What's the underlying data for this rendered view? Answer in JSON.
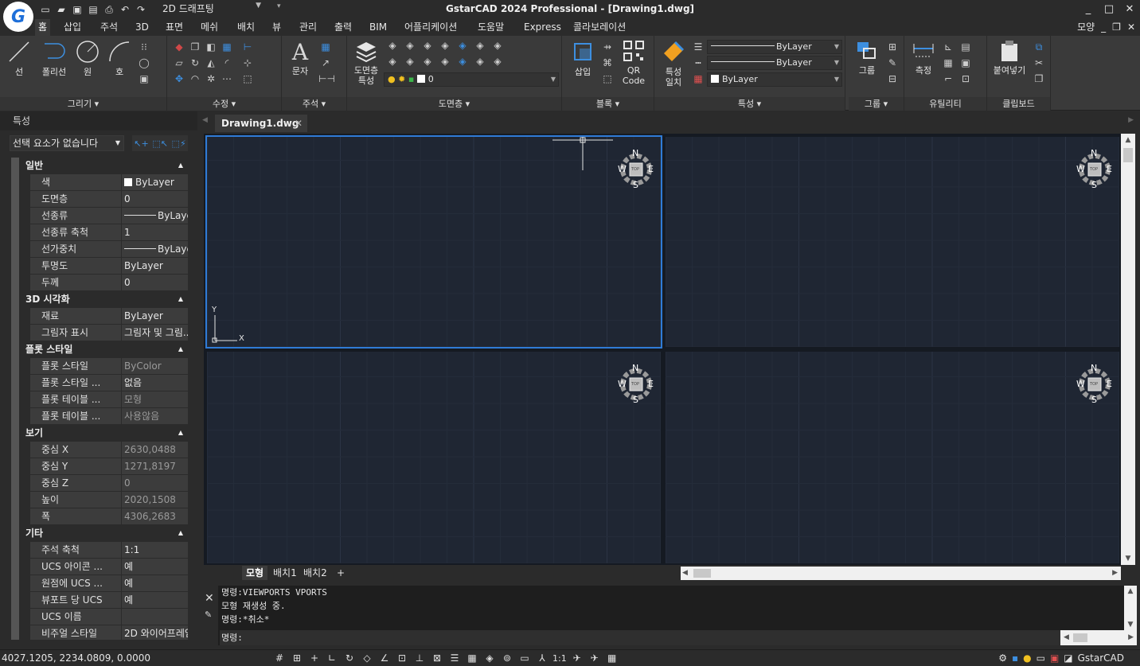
{
  "window": {
    "title": "GstarCAD 2024 Professional - [Drawing1.dwg]",
    "logo_letter": "G",
    "workspace": "2D 드래프팅",
    "controls": [
      "_",
      "□",
      "✕"
    ]
  },
  "ribbon_tabs": [
    "홈",
    "삽입",
    "주석",
    "3D",
    "표면",
    "메쉬",
    "배치",
    "뷰",
    "관리",
    "출력",
    "BIM",
    "어플리케이션",
    "도움말",
    "Express",
    "콜라보레이션"
  ],
  "active_tab": "홈",
  "tabs_right": {
    "label": "모양",
    "min": "_",
    "restore": "❐",
    "close": "✕"
  },
  "panels": {
    "draw": {
      "title": "그리기",
      "tools": [
        "선",
        "폴리선",
        "원",
        "호"
      ]
    },
    "modify": {
      "title": "수정"
    },
    "annotation": {
      "title": "주석",
      "tools": [
        "문자"
      ]
    },
    "layers": {
      "title": "도면층",
      "tools": [
        "도면층",
        "특성"
      ],
      "layer_current": "0"
    },
    "block": {
      "title": "블록",
      "tools": [
        "삽입",
        "QR",
        "Code"
      ]
    },
    "properties": {
      "title": "특성",
      "tools": [
        "특성",
        "일치"
      ],
      "color": "ByLayer",
      "linetype": "ByLayer",
      "lineweight": "ByLayer"
    },
    "groups": {
      "title": "그룹",
      "tools": [
        "그룹"
      ]
    },
    "utilities": {
      "title": "유틸리티",
      "tools": [
        "측정"
      ]
    },
    "clipboard": {
      "title": "클립보드",
      "tools": [
        "붙여넣기"
      ]
    }
  },
  "properties_palette": {
    "header": "특성",
    "selection": "선택 요소가 없습니다",
    "groups": [
      {
        "name": "일반",
        "rows": [
          {
            "key": "색",
            "value": "ByLayer",
            "swatch": true
          },
          {
            "key": "도면층",
            "value": "0"
          },
          {
            "key": "선종류",
            "value": "ByLayer",
            "line": true
          },
          {
            "key": "선종류 축척",
            "value": "1"
          },
          {
            "key": "선가중치",
            "value": "ByLayer",
            "line": true
          },
          {
            "key": "투명도",
            "value": "ByLayer"
          },
          {
            "key": "두께",
            "value": "0"
          }
        ]
      },
      {
        "name": "3D 시각화",
        "rows": [
          {
            "key": "재료",
            "value": "ByLayer"
          },
          {
            "key": "그림자 표시",
            "value": "그림자 및 그림..."
          }
        ]
      },
      {
        "name": "플롯 스타일",
        "rows": [
          {
            "key": "플롯 스타일",
            "value": "ByColor",
            "dim": true
          },
          {
            "key": "플롯 스타일 ...",
            "value": "없음"
          },
          {
            "key": "플롯 테이블 ...",
            "value": "모형",
            "dim": true
          },
          {
            "key": "플롯 테이블 ...",
            "value": "사용않음",
            "dim": true
          }
        ]
      },
      {
        "name": "보기",
        "rows": [
          {
            "key": "중심 X",
            "value": "2630,0488",
            "dim": true
          },
          {
            "key": "중심 Y",
            "value": "1271,8197",
            "dim": true
          },
          {
            "key": "중심 Z",
            "value": "0",
            "dim": true
          },
          {
            "key": "높이",
            "value": "2020,1508",
            "dim": true
          },
          {
            "key": "폭",
            "value": "4306,2683",
            "dim": true
          }
        ]
      },
      {
        "name": "기타",
        "rows": [
          {
            "key": "주석 축척",
            "value": "1:1"
          },
          {
            "key": "UCS 아이콘 ...",
            "value": "예"
          },
          {
            "key": "원점에 UCS ...",
            "value": "예"
          },
          {
            "key": "뷰포트 당 UCS",
            "value": "예"
          },
          {
            "key": "UCS 이름",
            "value": ""
          },
          {
            "key": "비주얼 스타일",
            "value": "2D 와이어프레임"
          }
        ]
      }
    ]
  },
  "document_tab": "Drawing1.dwg",
  "viewcube": {
    "n": "N",
    "s": "S",
    "e": "E",
    "w": "W",
    "face": "TOP"
  },
  "ucs": {
    "x": "X",
    "y": "Y"
  },
  "layout_tabs": [
    "모형",
    "배치1",
    "배치2",
    "+"
  ],
  "command_history": [
    "명령:VIEWPORTS VPORTS",
    "모형 재생성 중.",
    "명령:*취소*"
  ],
  "command_prompt": "명령:",
  "status": {
    "coords": "4027.1205, 2234.0809, 0.0000",
    "scale": "1:1",
    "brand": "GstarCAD"
  },
  "colors": {
    "accent": "#1e6fd9",
    "viewport_bg": "#1f2633",
    "active_viewport_border": "#2f7bd6"
  }
}
